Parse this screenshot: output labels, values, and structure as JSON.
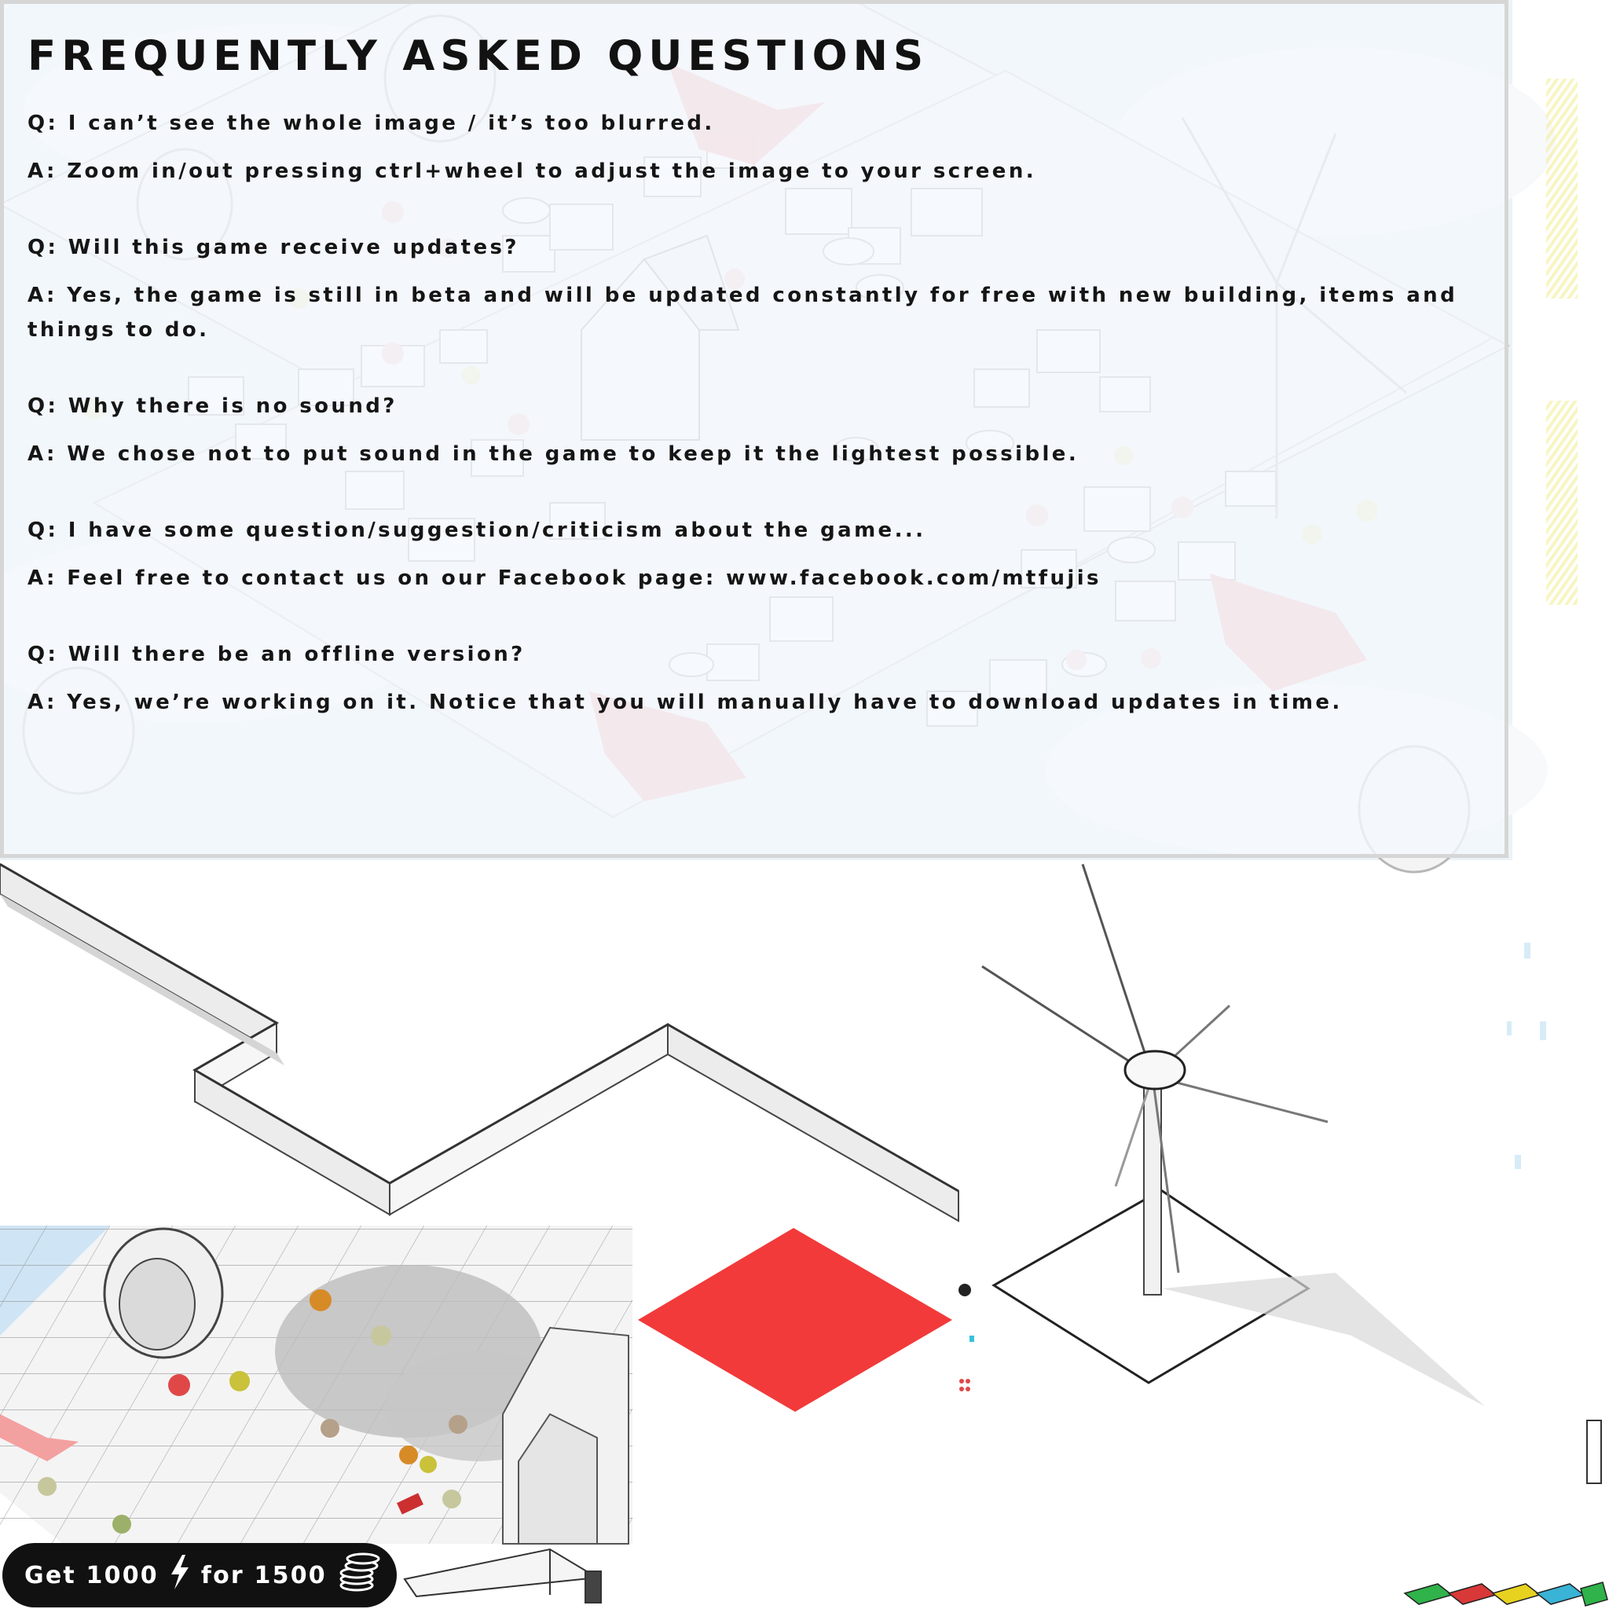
{
  "faq": {
    "title": "FREQUENTLY ASKED QUESTIONS",
    "items": [
      {
        "q": "Q: I can’t see the whole image / it’s too blurred.",
        "a": "A: Zoom in/out pressing ctrl+wheel to adjust the image to your screen."
      },
      {
        "q": "Q: Will this game receive updates?",
        "a": "A: Yes, the game is still in beta and will be updated constantly for free with new building, items and things to do."
      },
      {
        "q": "Q: Why there is no sound?",
        "a": "A: We chose not to put sound in the game to keep it the lightest possible."
      },
      {
        "q": "Q: I have some question/suggestion/criticism about the game...",
        "a": "A: Feel free to contact us on our Facebook page: www.facebook.com/mtfujis"
      },
      {
        "q": "Q: Will there be an offline version?",
        "a": "A: Yes, we’re working on it. Notice that you will manually have to download updates in time."
      }
    ]
  },
  "offer": {
    "prefix": "Get 1000",
    "middle": "for 1500",
    "energy_icon": "lightning-bolt-icon",
    "currency_icon": "coin-stack-icon"
  },
  "colors": {
    "selection_tile": "#f23a3a",
    "ink": "#121212",
    "sky": "#d6e9f6",
    "plane": "#e84c4c",
    "car_colors": [
      "#2fb34a",
      "#d93838",
      "#e6d21f",
      "#39b3d6",
      "#2fb34a"
    ]
  }
}
